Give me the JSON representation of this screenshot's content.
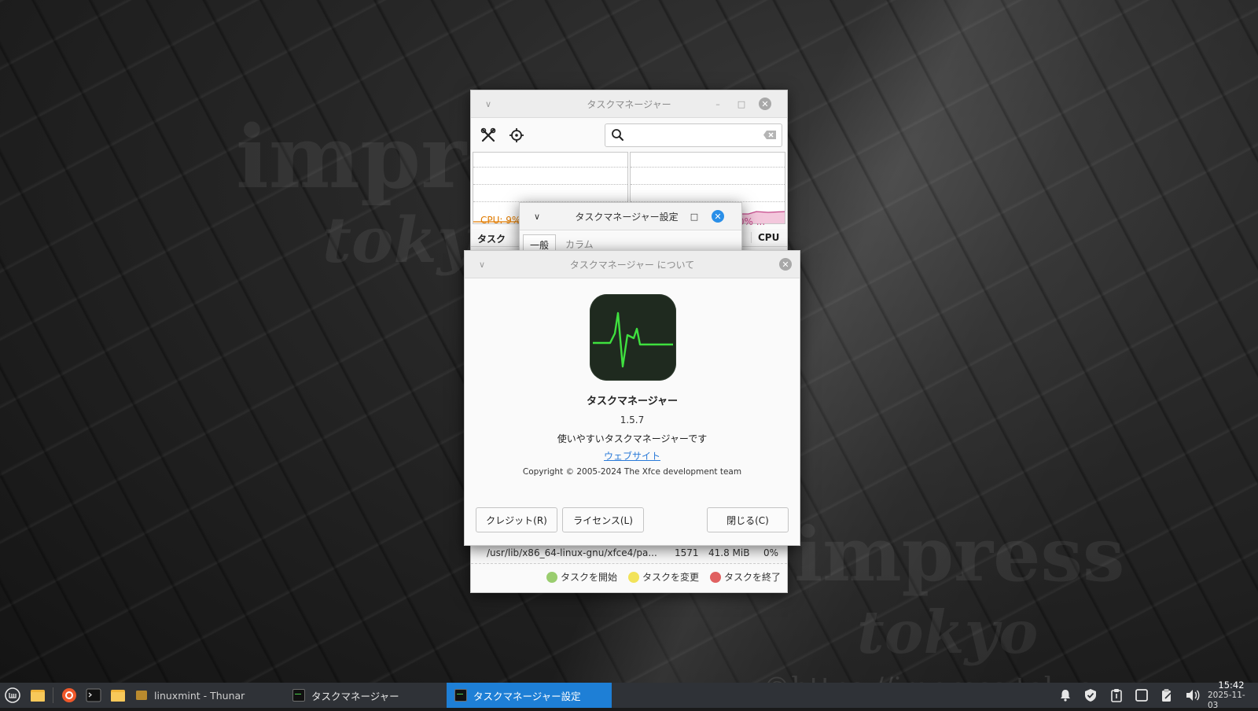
{
  "desktop": {
    "watermarks": [
      "impress",
      "tokyo",
      "impress",
      "tokyo",
      "©https://impress.tokyo"
    ]
  },
  "task_manager": {
    "title": "タスクマネージャー",
    "search": {
      "value": "",
      "placeholder": ""
    },
    "cpu_label": "CPU: 9%",
    "swap_label": "プ: 0% ...",
    "table": {
      "col_task": "タスク",
      "col_cpu": "CPU",
      "row": {
        "command": "/usr/lib/x86_64-linux-gnu/xfce4/pa...",
        "pid": "1571",
        "memory": "41.8 MiB",
        "cpu": "0%"
      }
    },
    "legend": {
      "start": "タスクを開始",
      "change": "タスクを変更",
      "end": "タスクを終了"
    },
    "colors": {
      "cpu": "#e07b00",
      "memory": "#c64a8c",
      "start": "#9acd6f",
      "change": "#f2e35a",
      "end": "#e06161"
    }
  },
  "settings": {
    "title": "タスクマネージャー設定",
    "tabs": [
      "一般",
      "カラム"
    ]
  },
  "about": {
    "title": "タスクマネージャー について",
    "app_name": "タスクマネージャー",
    "version": "1.5.7",
    "description": "使いやすいタスクマネージャーです",
    "website": "ウェブサイト",
    "copyright": "Copyright © 2005-2024 The Xfce development team",
    "buttons": {
      "credits": "クレジット(R)",
      "license": "ライセンス(L)",
      "close": "閉じる(C)"
    }
  },
  "taskbar": {
    "tasks": [
      {
        "label": "linuxmint - Thunar"
      },
      {
        "label": "タスクマネージャー"
      },
      {
        "label": "タスクマネージャー設定"
      }
    ],
    "clock": {
      "time": "15:42",
      "date": "2025-11-03"
    },
    "accent": "#1e7fd6"
  }
}
